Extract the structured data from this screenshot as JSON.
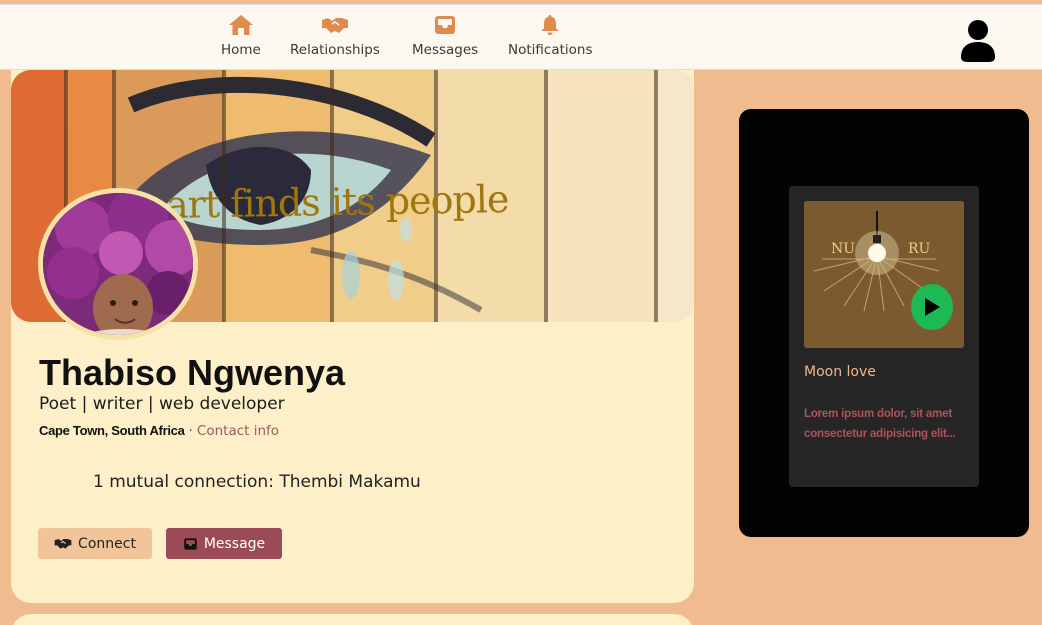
{
  "nav": {
    "items": [
      {
        "label": "Home",
        "icon": "home-icon"
      },
      {
        "label": "Relationships",
        "icon": "handshake-icon"
      },
      {
        "label": "Messages",
        "icon": "inbox-icon"
      },
      {
        "label": "Notifications",
        "icon": "bell-icon"
      }
    ],
    "account_icon": "user-icon"
  },
  "profile": {
    "banner_slogan": "art finds its people",
    "name": "Thabiso Ngwenya",
    "headline": "Poet | writer | web developer",
    "location": "Cape Town, South Africa",
    "separator": " · ",
    "contact_label": "Contact info",
    "mutual": "1 mutual connection: Thembi Makamu",
    "connect_label": "Connect",
    "message_label": "Message"
  },
  "player": {
    "album_left": "NU",
    "album_right": "RU",
    "track_title": "Moon love",
    "track_desc": "Lorem ipsum dolor, sit amet consectetur adipisicing elit..."
  },
  "colors": {
    "accent": "#e08a4f",
    "page_bg": "#f0bc8f",
    "card_bg": "#fdefc8",
    "message_btn": "#9b4b55",
    "connect_btn": "#f2c49a",
    "play_green": "#1db954"
  }
}
